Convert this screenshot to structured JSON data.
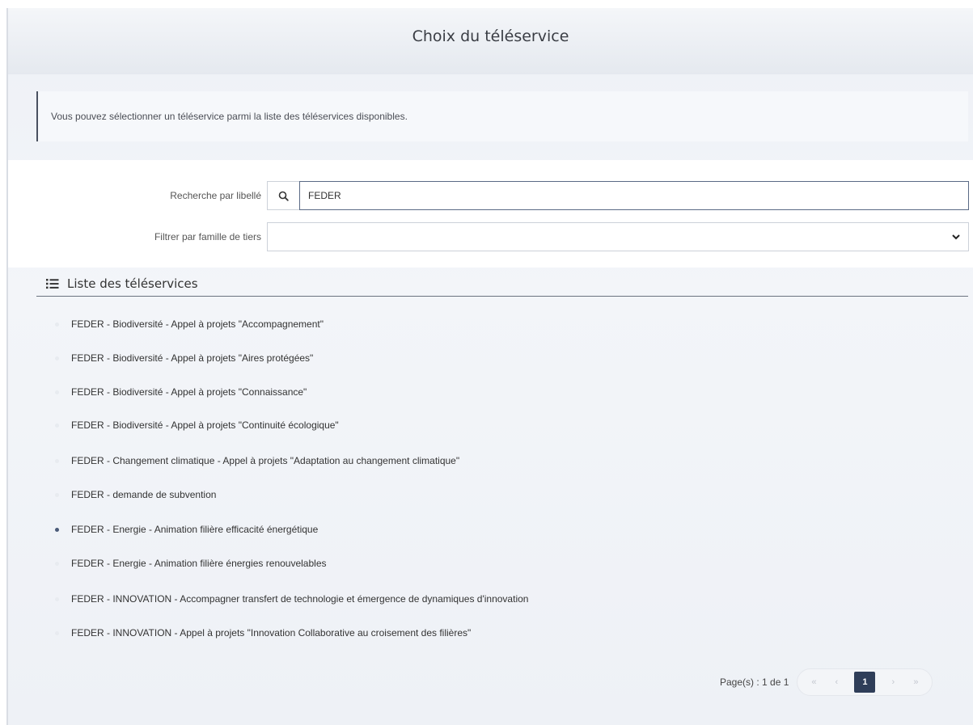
{
  "header": {
    "title": "Choix du téléservice"
  },
  "info": {
    "text": "Vous pouvez sélectionner un téléservice parmi la liste des téléservices disponibles."
  },
  "filters": {
    "search_label": "Recherche par libellé",
    "search_value": "FEDER",
    "family_label": "Filtrer par famille de tiers",
    "family_value": ""
  },
  "list": {
    "title": "Liste des téléservices",
    "items": [
      "FEDER - Biodiversité - Appel à projets \"Accompagnement\"",
      "FEDER - Biodiversité - Appel à projets \"Aires protégées\"",
      "FEDER - Biodiversité - Appel à projets \"Connaissance\"",
      "FEDER - Biodiversité - Appel à projets \"Continuité écologique\"",
      "FEDER - Changement climatique - Appel à projets \"Adaptation au changement climatique\"",
      "FEDER - demande de subvention",
      "FEDER - Energie - Animation filière efficacité énergétique",
      "FEDER - Energie - Animation filière énergies renouvelables",
      "FEDER - INNOVATION - Accompagner transfert de technologie et émergence de dynamiques d'innovation",
      "FEDER - INNOVATION - Appel à projets \"Innovation Collaborative au croisement des filières\""
    ],
    "highlighted_index": 6
  },
  "pagination": {
    "label": "Page(s) : 1 de 1",
    "first": "«",
    "prev": "‹",
    "current": "1",
    "next": "›",
    "last": "»"
  },
  "colors": {
    "accent": "#2f3e59",
    "background": "#eef1f6"
  }
}
